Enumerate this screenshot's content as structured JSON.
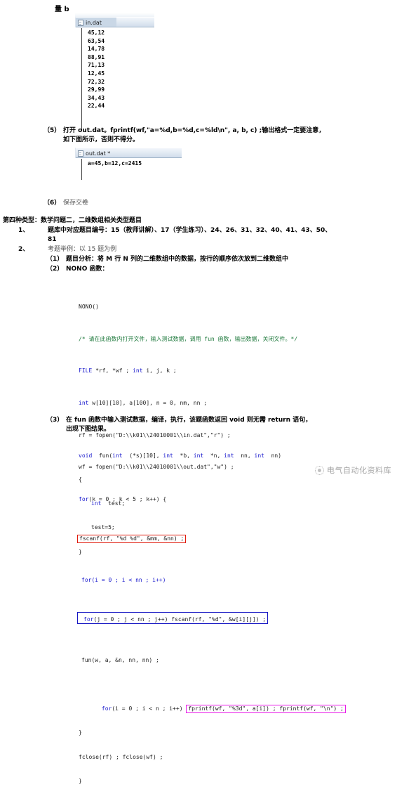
{
  "page": {
    "top_fragment": "量 b",
    "watermark": {
      "text": "电气自动化资料库",
      "logo_icon": "dotted-circle-logo-icon"
    }
  },
  "in_file_window": {
    "icon": "text-document-icon",
    "title": "in.dat",
    "lines": [
      "45,12",
      "63,54",
      "14,78",
      "88,91",
      "71,13",
      "12,45",
      "72,32",
      "29,99",
      "34,43",
      "22,44"
    ]
  },
  "out_file_window": {
    "icon": "text-document-icon",
    "title": "out.dat *",
    "lines": [
      "a=45,b=12,c=2415"
    ]
  },
  "body_text": {
    "step5_num": "（5）",
    "step5_line1": "打开 out.dat。fprintf(wf,\"a=%d,b=%d,c=%ld\\n\", a, b, c) ;输出格式一定要注意，",
    "step5_line2": "如下图所示，否则不得分。",
    "step6_num": "（6）",
    "step6_text": "保存交卷",
    "section_heading": "第四种类型：数学问题二，二维数组相关类型题目",
    "item1_num": "1、",
    "item1_line1": "题库中对应题目编号：15（教师讲解）、17（学生练习）、24、26、31、32、40、41、43、50、",
    "item1_line2": "81",
    "item2_num": "2、",
    "item2_text": "考题举例：以 15 题为例",
    "sub1_num": "（1）",
    "sub1_text": "题目分析：将 M 行 N 列的二维数组中的数据，按行的顺序依次放到二维数组中",
    "sub2_num": "（2）",
    "sub2_text": "NONO 函数：",
    "sub3_num": "（3）",
    "sub3_line1": "在 fun 函数中输入测试数据，编译，执行，该题函数返回 void 则无需 return 语句，",
    "sub3_line2": "出现下图结果。"
  },
  "nono_code": {
    "l01": "NONO()",
    "l02_comment": "/* 请在此函数内打开文件，输入测试数据，调用 fun 函数，输出数据，关闭文件。*/",
    "l03_a": "FILE",
    "l03_b": " *rf, *wf ; ",
    "l03_c": "int",
    "l03_d": " i, j, k ;",
    "l04_a": "int",
    "l04_b": " w[10][10], a[100], n = 0, nm, nn ;",
    "l05": "rf = fopen(\"D:\\\\k01\\\\24010001\\\\in.dat\",\"r\") ;",
    "l06": "wf = fopen(\"D:\\\\k01\\\\24010001\\\\out.dat\",\"w\") ;",
    "l07_a": "for",
    "l07_b": "(k = 0 ; k < 5 ; k++) {",
    "l08_boxed": "fscanf(rf, \"%d %d\", &mm, &nn) ;",
    "l09_a": "for",
    "l09_b": "(i = 0 ; i < nn ; i++)",
    "l10_a": "for",
    "l10_b": "(j = 0 ; j < nn ; j++) fscanf(rf, \"%d\", &w[i][j]) ;",
    "l11": "fun(w, a, &n, nn, nn) ;",
    "l12_a": "for",
    "l12_b": "(i = 0 ; i < n ; i++) ",
    "l12_boxed": "fprintf(wf, \"%3d\", a[i]) ; fprintf(wf, \"\\n\") ;",
    "l13": "}",
    "l14": "fclose(rf) ; fclose(wf) ;",
    "l15": "}"
  },
  "fun_code": {
    "f01_a": "void",
    "f01_b": "  fun(",
    "f01_c": "int",
    "f01_d": "  (*s)[10], ",
    "f01_e": "int",
    "f01_f": "  *b, ",
    "f01_g": "int",
    "f01_h": "  *n, ",
    "f01_i": "int",
    "f01_j": "  nn, ",
    "f01_k": "int",
    "f01_l": "  nn)",
    "f02": "{",
    "f03_a": "int",
    "f03_b": "  test;",
    "f04": "test=5;",
    "f05": "}"
  },
  "colors": {
    "highlight_red": "#e01b0c",
    "highlight_blue": "#1818c4",
    "highlight_magenta": "#e816e8",
    "keyword_blue": "#1515cc",
    "comment_green": "#1f7a3d"
  }
}
